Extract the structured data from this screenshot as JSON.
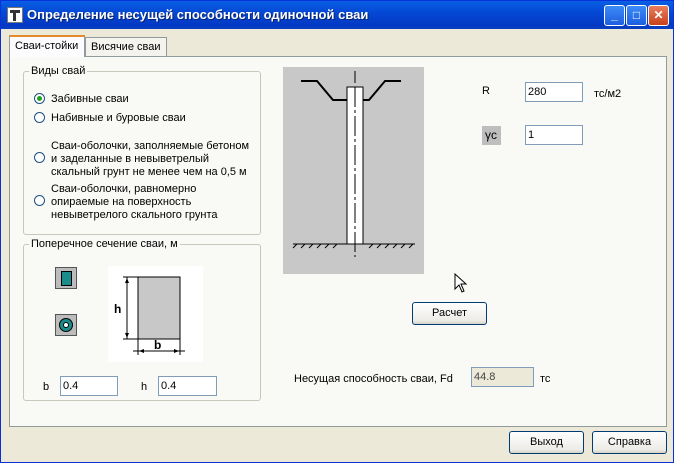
{
  "window": {
    "title": "Определение несущей способности одиночной сваи"
  },
  "tabs": [
    {
      "label": "Сваи-стойки"
    },
    {
      "label": "Висячие сваи"
    }
  ],
  "pile_types": {
    "legend": "Виды свай",
    "items": [
      {
        "lines": [
          "Забивные сваи"
        ],
        "selected": true
      },
      {
        "lines": [
          "Набивные и буровые сваи"
        ],
        "selected": false
      },
      {
        "lines": [
          "Сваи-оболочки, заполняемые бетоном",
          "и заделанные в невыветрелый",
          "скальный грунт не менее чем на 0,5 м"
        ],
        "selected": false
      },
      {
        "lines": [
          "Сваи-оболочки, равномерно",
          "опираемые на поверхность",
          "невыветрелого скального грунта"
        ],
        "selected": false
      }
    ]
  },
  "cross_section": {
    "legend": "Поперечное сечение сваи, м",
    "dim_h": "h",
    "dim_b": "b",
    "b_label": "b",
    "b_value": "0.4",
    "h_label": "h",
    "h_value": "0.4"
  },
  "params": {
    "R_label": "R",
    "R_value": "280",
    "R_unit": "тс/м2",
    "gamma_label": "γc",
    "gamma_value": "1"
  },
  "buttons": {
    "calc": "Расчет",
    "exit": "Выход",
    "help": "Справка"
  },
  "result": {
    "label": "Несущая способность сваи, Fd",
    "value": "44.8",
    "unit": "тс"
  },
  "colors": {
    "titlebar": "#0449D6",
    "accent_tab": "#E68B2C",
    "drawing_bg": "#C8C8C8"
  }
}
